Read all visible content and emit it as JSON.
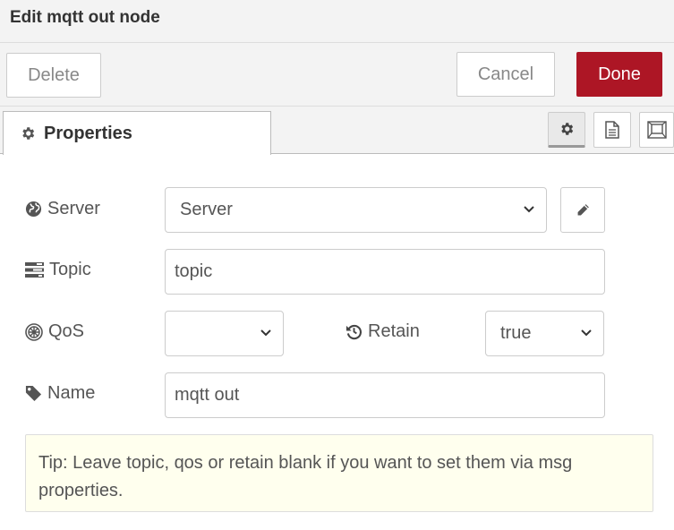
{
  "dialog": {
    "title": "Edit mqtt out node",
    "delete_label": "Delete",
    "cancel_label": "Cancel",
    "done_label": "Done"
  },
  "tabs": {
    "properties_label": "Properties",
    "icons": [
      "gear-icon",
      "document-icon",
      "frame-icon"
    ]
  },
  "form": {
    "server_label": "Server",
    "server_value": "Server",
    "topic_label": "Topic",
    "topic_value": "topic",
    "qos_label": "QoS",
    "qos_value": "",
    "retain_label": "Retain",
    "retain_value": "true",
    "name_label": "Name",
    "name_value": "mqtt out"
  },
  "tip": "Tip: Leave topic, qos or retain blank if you want to set them via msg properties.",
  "colors": {
    "done_button": "#ad1625",
    "tip_background": "#ffffee",
    "header_background": "#f3f3f3"
  }
}
